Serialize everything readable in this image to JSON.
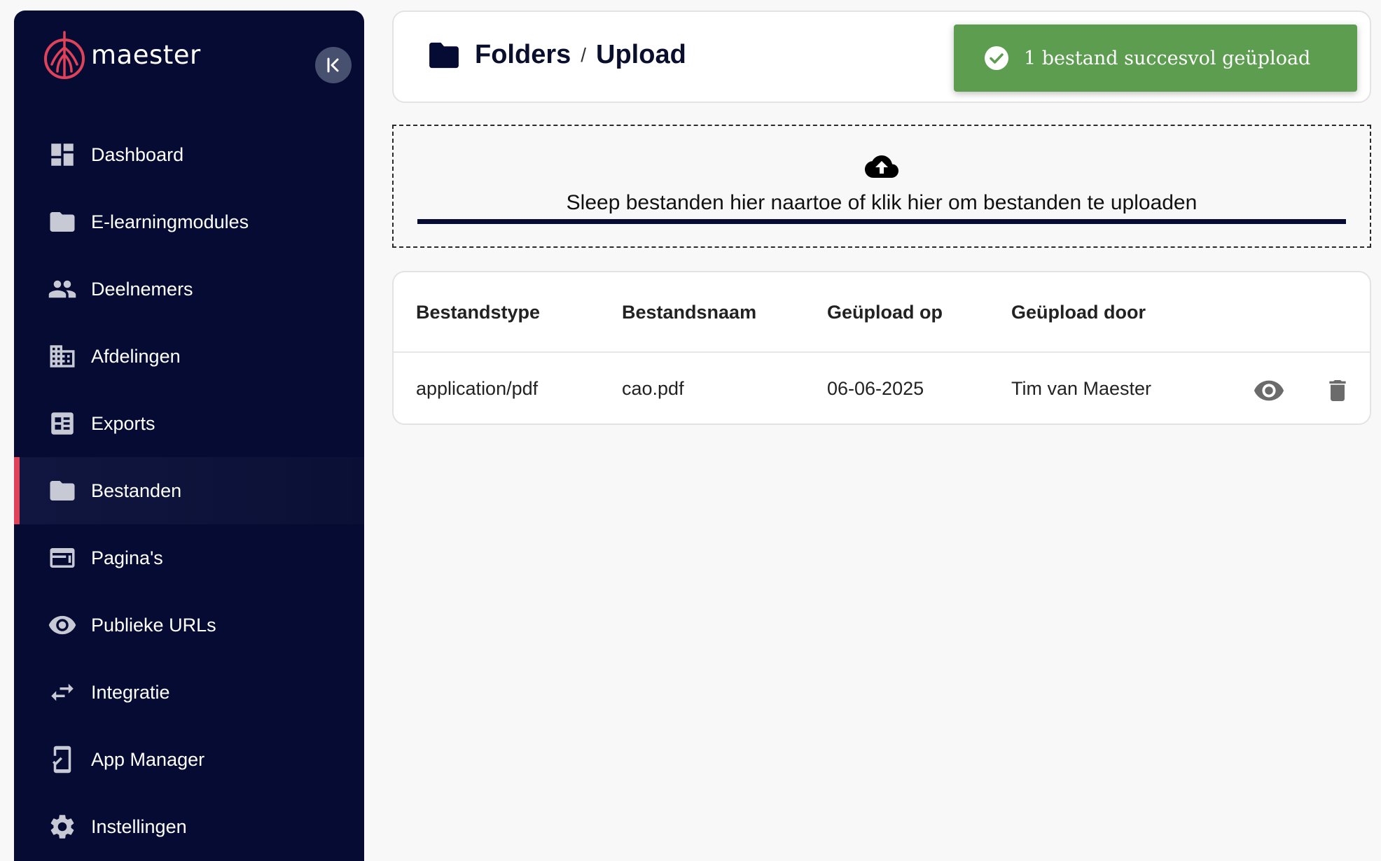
{
  "app": {
    "name": "maester"
  },
  "sidebar": {
    "items": [
      {
        "label": "Dashboard",
        "icon": "dashboard-icon",
        "active": false
      },
      {
        "label": "E-learningmodules",
        "icon": "folder-icon",
        "active": false
      },
      {
        "label": "Deelnemers",
        "icon": "people-icon",
        "active": false
      },
      {
        "label": "Afdelingen",
        "icon": "building-icon",
        "active": false
      },
      {
        "label": "Exports",
        "icon": "list-icon",
        "active": false
      },
      {
        "label": "Bestanden",
        "icon": "folder-icon",
        "active": true
      },
      {
        "label": "Pagina's",
        "icon": "web-page-icon",
        "active": false
      },
      {
        "label": "Publieke URLs",
        "icon": "eye-icon",
        "active": false
      },
      {
        "label": "Integratie",
        "icon": "swap-arrows-icon",
        "active": false
      },
      {
        "label": "App Manager",
        "icon": "phone-check-icon",
        "active": false
      },
      {
        "label": "Instellingen",
        "icon": "gear-icon",
        "active": false
      }
    ],
    "accent_color": "#e0425a",
    "background_color": "#050b33"
  },
  "header": {
    "breadcrumb": [
      "Folders",
      "Upload"
    ],
    "separator": "/"
  },
  "toast": {
    "message": "1 bestand succesvol geüpload",
    "color": "#5c9d50"
  },
  "dropzone": {
    "text": "Sleep bestanden hier naartoe of klik hier om bestanden te uploaden"
  },
  "table": {
    "columns": [
      "Bestandstype",
      "Bestandsnaam",
      "Geüpload op",
      "Geüpload door"
    ],
    "rows": [
      {
        "type": "application/pdf",
        "name": "cao.pdf",
        "date": "06-06-2025",
        "uploaded_by": "Tim van Maester"
      }
    ]
  }
}
